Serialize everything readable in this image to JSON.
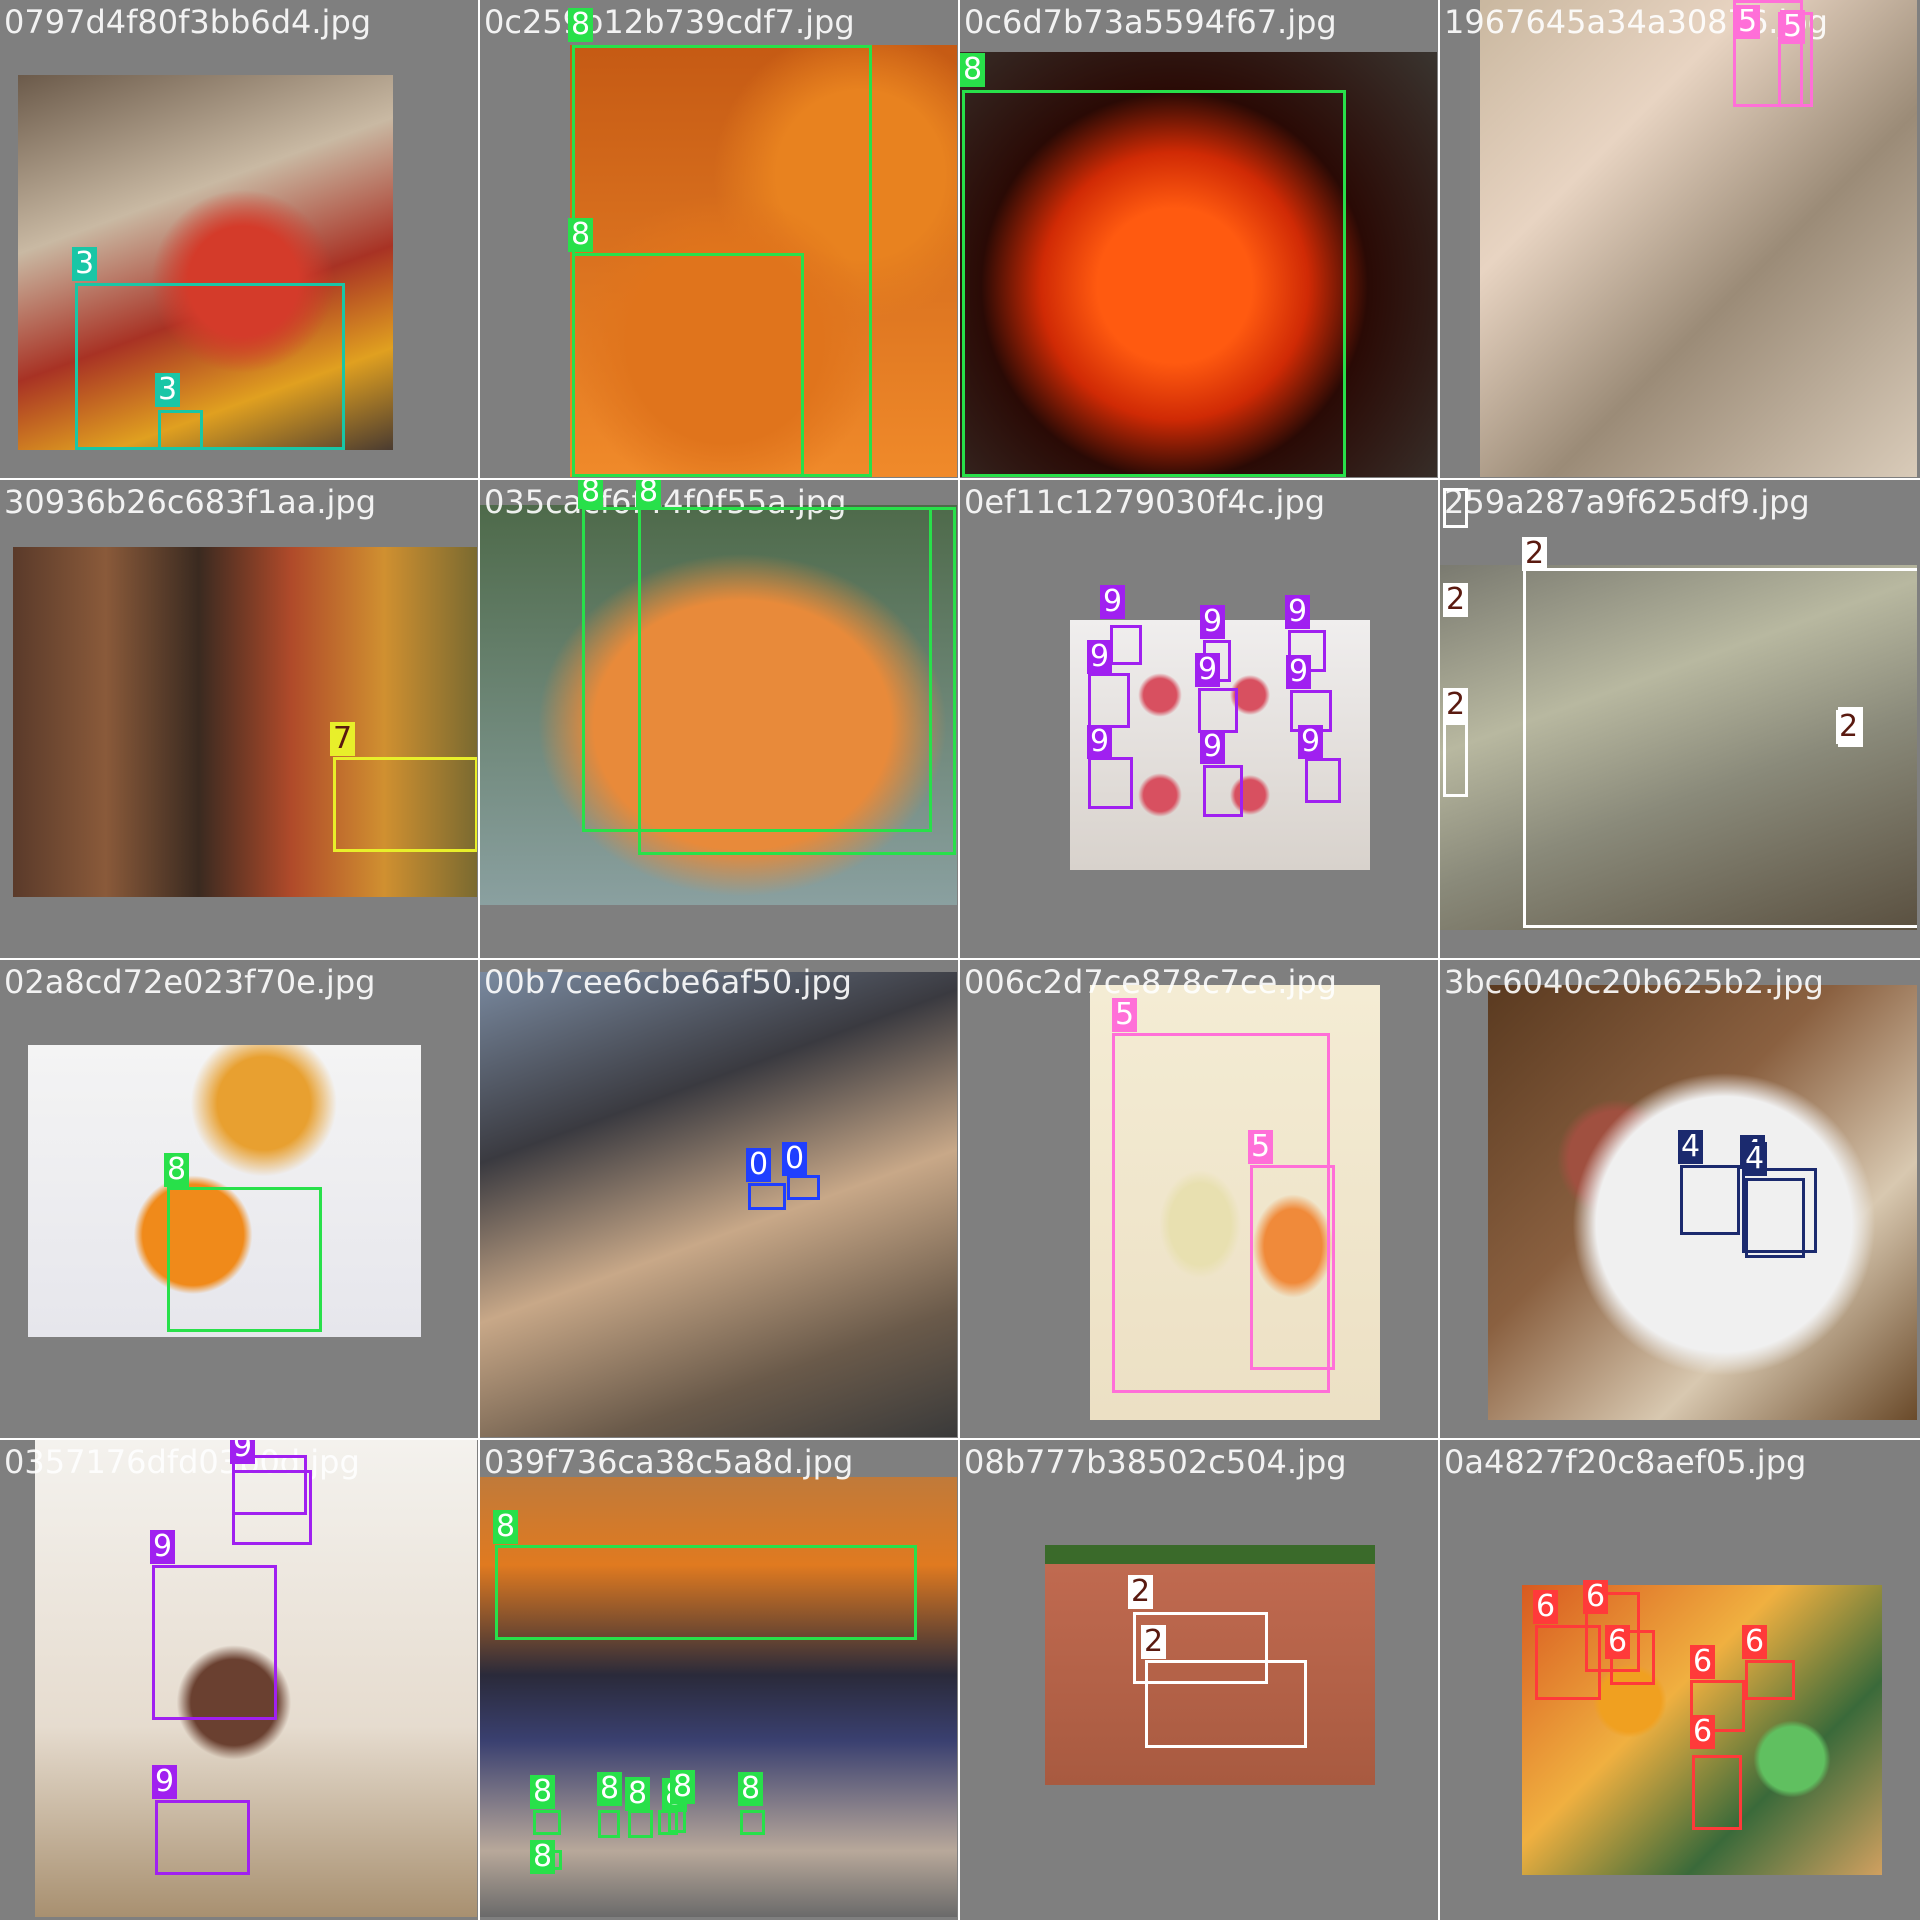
{
  "class_colors": {
    "0": "#1f3fff",
    "2": "#ffffff",
    "3": "#19c6a6",
    "4": "#1b2a6e",
    "5": "#ff6fd8",
    "6": "#ff3a3a",
    "7": "#e8ef2a",
    "8": "#28e04a",
    "9": "#a020f0"
  },
  "tiles": [
    {
      "filename": "0797d4f80f3bb6d4.jpg",
      "scene": "market-peppers",
      "boxes": [
        {
          "cls": "3"
        },
        {
          "cls": "3"
        }
      ]
    },
    {
      "filename": "0c259b12b739cdf7.jpg",
      "scene": "pumpkins-closeup",
      "boxes": [
        {
          "cls": "8"
        },
        {
          "cls": "8"
        }
      ]
    },
    {
      "filename": "0c6d7b73a5594f67.jpg",
      "scene": "jack-o-lantern",
      "boxes": [
        {
          "cls": "8"
        }
      ]
    },
    {
      "filename": "1967645a34a30876.jpg",
      "scene": "face-collage",
      "boxes": [
        {
          "cls": "5"
        },
        {
          "cls": "5"
        }
      ]
    },
    {
      "filename": "30936b26c683f1aa.jpg",
      "scene": "gourds-records",
      "boxes": [
        {
          "cls": "7"
        }
      ]
    },
    {
      "filename": "035cacf6f44f0f55a.jpg",
      "scene": "pumpkin-sign",
      "boxes": [
        {
          "cls": "8"
        },
        {
          "cls": "8"
        }
      ]
    },
    {
      "filename": "0ef11c1279030f4c.jpg",
      "scene": "cupcakes",
      "boxes": [
        {
          "cls": "9"
        },
        {
          "cls": "9"
        },
        {
          "cls": "9"
        },
        {
          "cls": "9"
        },
        {
          "cls": "9"
        },
        {
          "cls": "9"
        },
        {
          "cls": "9"
        },
        {
          "cls": "9"
        },
        {
          "cls": "9"
        }
      ]
    },
    {
      "filename": "259a287a9f625df9.jpg",
      "scene": "banana-market",
      "boxes": [
        {
          "cls": "2"
        },
        {
          "cls": "2"
        },
        {
          "cls": "2"
        },
        {
          "cls": "2"
        }
      ]
    },
    {
      "filename": "02a8cd72e023f70e.jpg",
      "scene": "carved-mini-pumpkin",
      "boxes": [
        {
          "cls": "8"
        }
      ]
    },
    {
      "filename": "00b7cee6cbe6af50.jpg",
      "scene": "market-stall",
      "boxes": [
        {
          "cls": "0"
        },
        {
          "cls": "0"
        }
      ]
    },
    {
      "filename": "006c2d7ce878c7ce.jpg",
      "scene": "carrot-illustration",
      "boxes": [
        {
          "cls": "5"
        },
        {
          "cls": "5"
        }
      ]
    },
    {
      "filename": "3bc6040c20b625b2.jpg",
      "scene": "dinner-plate",
      "boxes": [
        {
          "cls": "4"
        },
        {
          "cls": "4"
        },
        {
          "cls": "4"
        }
      ]
    },
    {
      "filename": "0357176dfd03b0d.jpg",
      "scene": "cakes",
      "boxes": [
        {
          "cls": "9"
        },
        {
          "cls": "9"
        },
        {
          "cls": "9"
        },
        {
          "cls": "9"
        }
      ]
    },
    {
      "filename": "039f736ca38c5a8d.jpg",
      "scene": "halloween-show",
      "boxes": [
        {
          "cls": "8"
        },
        {
          "cls": "8"
        },
        {
          "cls": "8"
        },
        {
          "cls": "8"
        },
        {
          "cls": "8"
        },
        {
          "cls": "8"
        },
        {
          "cls": "8"
        },
        {
          "cls": "8"
        }
      ]
    },
    {
      "filename": "08b777b38502c504.jpg",
      "scene": "bananas-table",
      "boxes": [
        {
          "cls": "2"
        },
        {
          "cls": "2"
        }
      ]
    },
    {
      "filename": "0a4827f20c8aef05.jpg",
      "scene": "fruit-crate",
      "boxes": [
        {
          "cls": "6"
        },
        {
          "cls": "6"
        },
        {
          "cls": "6"
        },
        {
          "cls": "6"
        },
        {
          "cls": "6"
        },
        {
          "cls": "6"
        }
      ]
    }
  ]
}
